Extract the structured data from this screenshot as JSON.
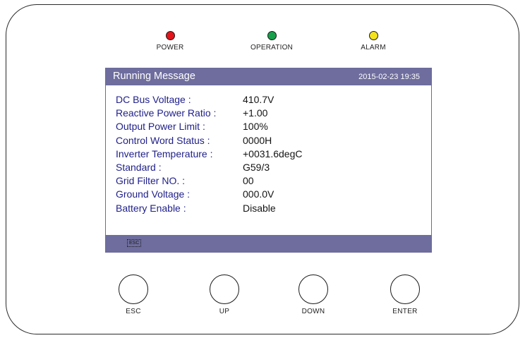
{
  "indicators": [
    {
      "label": "POWER",
      "color": "#e3141a"
    },
    {
      "label": "OPERATION",
      "color": "#17a04a"
    },
    {
      "label": "ALARM",
      "color": "#f4e21c"
    }
  ],
  "screen": {
    "title": "Running Message",
    "datetime": "2015-02-23   19:35",
    "rows": [
      {
        "label": "DC Bus Voltage :",
        "value": "410.7V"
      },
      {
        "label": "Reactive Power Ratio :",
        "value": "+1.00"
      },
      {
        "label": "Output Power Limit :",
        "value": "100%"
      },
      {
        "label": "Control Word Status :",
        "value": "0000H"
      },
      {
        "label": "Inverter Temperature :",
        "value": "+0031.6degC"
      },
      {
        "label": "Standard :",
        "value": "G59/3"
      },
      {
        "label": "Grid Filter NO. :",
        "value": "00"
      },
      {
        "label": "Ground Voltage :",
        "value": "000.0V"
      },
      {
        "label": "Battery Enable :",
        "value": "Disable"
      }
    ],
    "footer_key": "ESC"
  },
  "buttons": [
    {
      "label": "ESC"
    },
    {
      "label": "UP"
    },
    {
      "label": "DOWN"
    },
    {
      "label": "ENTER"
    }
  ]
}
